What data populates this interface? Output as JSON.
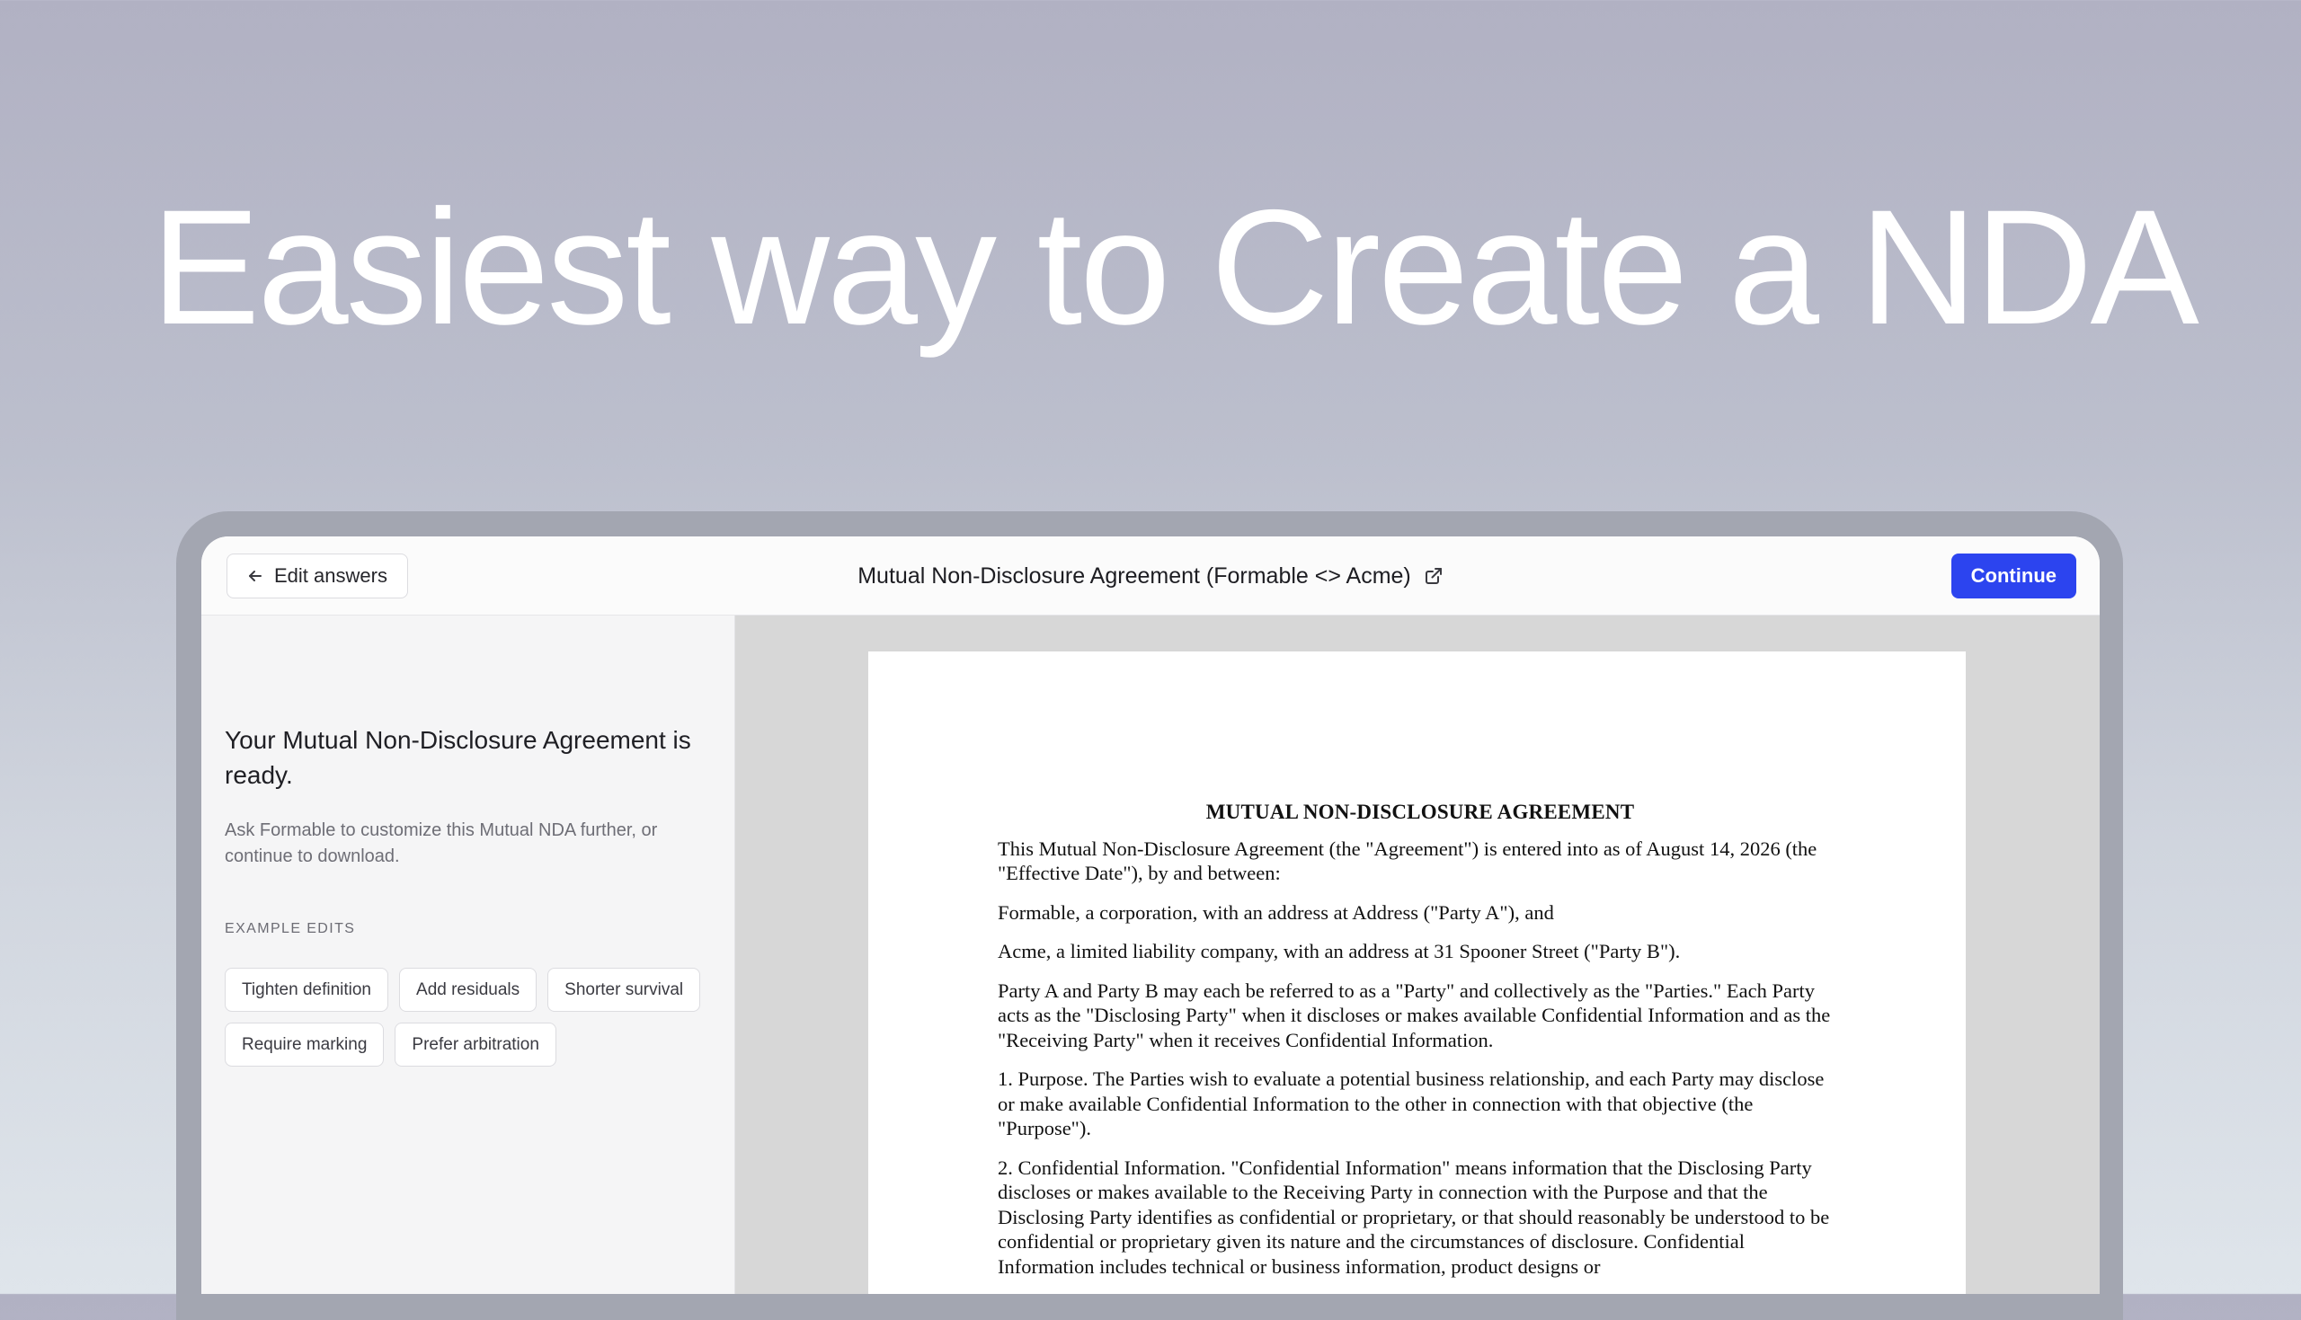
{
  "hero": {
    "title": "Easiest way to Create a NDA"
  },
  "topbar": {
    "edit_label": "Edit answers",
    "doc_title": "Mutual Non-Disclosure Agreement (Formable <> Acme)",
    "continue_label": "Continue"
  },
  "sidebar": {
    "heading": "Your Mutual Non-Disclosure Agreement is ready.",
    "description": "Ask Formable to customize this Mutual NDA further, or continue to download.",
    "examples_label": "EXAMPLE EDITS",
    "chips": [
      "Tighten definition",
      "Add residuals",
      "Shorter survival",
      "Require marking",
      "Prefer arbitration"
    ]
  },
  "document": {
    "heading": "MUTUAL NON-DISCLOSURE AGREEMENT",
    "paragraphs": [
      "This Mutual Non-Disclosure Agreement (the \"Agreement\") is entered into as of August 14, 2026 (the \"Effective Date\"), by and between:",
      "Formable, a corporation, with an address at Address (\"Party A\"), and",
      "Acme, a limited liability company, with an address at 31 Spooner Street (\"Party B\").",
      "Party A and Party B may each be referred to as a \"Party\" and collectively as the \"Parties.\" Each Party acts as the \"Disclosing Party\" when it discloses or makes available Confidential Information and as the \"Receiving Party\" when it receives Confidential Information.",
      "1. Purpose. The Parties wish to evaluate a potential business relationship, and each Party may disclose or make available Confidential Information to the other in connection with that objective (the \"Purpose\").",
      "2. Confidential Information. \"Confidential Information\" means information that the Disclosing Party discloses or makes available to the Receiving Party in connection with the Purpose and that the Disclosing Party identifies as confidential or proprietary, or that should reasonably be understood to be confidential or proprietary given its nature and the circumstances of disclosure. Confidential Information includes technical or business information, product designs or"
    ]
  }
}
